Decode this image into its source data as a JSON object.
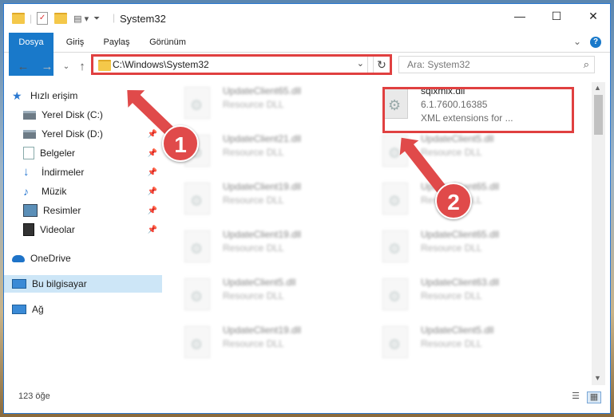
{
  "window": {
    "title": "System32",
    "minimize": "—",
    "maximize": "☐",
    "close": "✕"
  },
  "ribbon": {
    "tabs": [
      "Dosya",
      "Giriş",
      "Paylaş",
      "Görünüm"
    ],
    "help": "?",
    "expand": "⌄"
  },
  "nav": {
    "back": "←",
    "forward": "→",
    "recent": "⌄",
    "up": "↑",
    "refresh": "↻"
  },
  "address": {
    "path": "C:\\Windows\\System32",
    "dropdown": "⌄"
  },
  "search": {
    "placeholder": "Ara: System32",
    "icon": "search-icon"
  },
  "sidebar": {
    "items": [
      {
        "label": "Hızlı erişim",
        "icon": "star-icon"
      },
      {
        "label": "Yerel Disk (C:)",
        "icon": "drive-icon",
        "pinned": true
      },
      {
        "label": "Yerel Disk (D:)",
        "icon": "drive-icon",
        "pinned": true
      },
      {
        "label": "Belgeler",
        "icon": "documents-icon",
        "pinned": true
      },
      {
        "label": "İndirmeler",
        "icon": "download-icon",
        "pinned": true
      },
      {
        "label": "Müzik",
        "icon": "music-icon",
        "pinned": true
      },
      {
        "label": "Resimler",
        "icon": "pictures-icon",
        "pinned": true
      },
      {
        "label": "Videolar",
        "icon": "video-icon",
        "pinned": true
      },
      {
        "label": "OneDrive",
        "icon": "cloud-icon"
      },
      {
        "label": "Bu bilgisayar",
        "icon": "computer-icon",
        "selected": true
      },
      {
        "label": "Ağ",
        "icon": "network-icon"
      }
    ]
  },
  "files": {
    "highlight": {
      "name": "sqlxmlx.dll",
      "version": "6.1.7600.16385",
      "desc": "XML extensions for ..."
    },
    "left_col": [
      {
        "name": "UpdateClient65.dll",
        "type": "Resource DLL"
      },
      {
        "name": "UpdateClient21.dll",
        "type": "Resource DLL"
      },
      {
        "name": "UpdateClient19.dll",
        "type": "Resource DLL"
      },
      {
        "name": "UpdateClient19.dll",
        "type": "Resource DLL"
      },
      {
        "name": "UpdateClient5.dll",
        "type": "Resource DLL"
      },
      {
        "name": "UpdateClient19.dll",
        "type": "Resource DLL"
      }
    ],
    "right_col": [
      {
        "name": "UpdateClient5.dll",
        "type": "Resource DLL"
      },
      {
        "name": "UpdateClient65.dll",
        "type": "Resource DLL"
      },
      {
        "name": "UpdateClient65.dll",
        "type": "Resource DLL"
      },
      {
        "name": "UpdateClient63.dll",
        "type": "Resource DLL"
      },
      {
        "name": "UpdateClient5.dll",
        "type": "Resource DLL"
      }
    ]
  },
  "status": {
    "count": "123 öğe"
  },
  "callouts": {
    "one": "1",
    "two": "2"
  },
  "colors": {
    "accent": "#1979ca",
    "highlight": "#e04040",
    "selection": "#cde6f7"
  }
}
